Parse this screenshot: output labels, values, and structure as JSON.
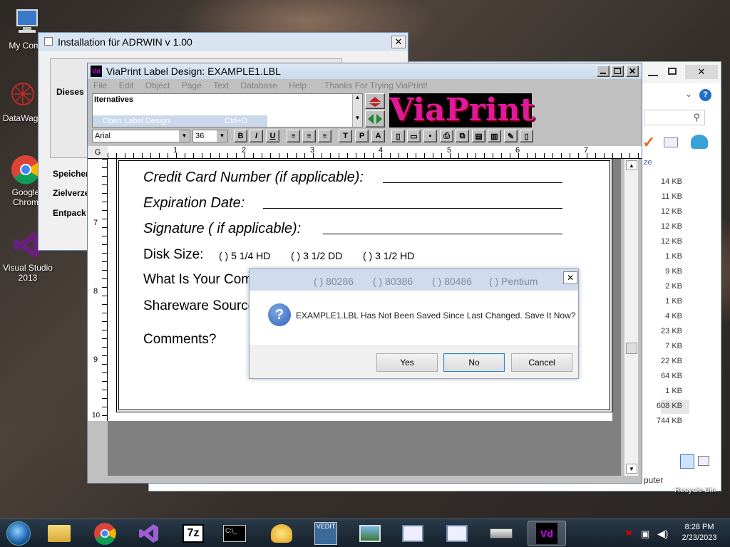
{
  "desktop": {
    "icons": [
      {
        "label": "My Comp"
      },
      {
        "label": "DataWage"
      },
      {
        "label": "Google Chrom"
      },
      {
        "label": "Visual Studio 2013"
      }
    ],
    "recycle_bin": "Recycle Bin"
  },
  "explorer": {
    "search_glyph": "⚲",
    "column_header": "ze",
    "sizes": [
      "14 KB",
      "11 KB",
      "12 KB",
      "12 KB",
      "12 KB",
      "1 KB",
      "9 KB",
      "2 KB",
      "1 KB",
      "4 KB",
      "23 KB",
      "7 KB",
      "22 KB",
      "64 KB",
      "1 KB",
      "608 KB",
      "744 KB"
    ],
    "nav_computer": "puter",
    "help_glyph": "?"
  },
  "install": {
    "title": "Installation für ADRWIN v 1.00",
    "label_dieses": "Dieses",
    "label_speicher": "Speicher",
    "label_zielverz": "Zielverze",
    "label_entpack": "Entpack"
  },
  "viaprint": {
    "title": "ViaPrint Label Design: EXAMPLE1.LBL",
    "menu": [
      "File",
      "Edit",
      "Object",
      "Page",
      "Text",
      "Database",
      "Help"
    ],
    "trial_text": "Thanks For Trying ViaPrint!",
    "list_header": "Iternatives",
    "list_selected": "Open Label Design",
    "list_selected_shortcut": "Ctrl+O",
    "logo": "ViaPrint",
    "font_name": "Arial",
    "font_size": "36",
    "fmt_bold": "B",
    "fmt_italic": "I",
    "fmt_underline": "U",
    "tool_t": "T",
    "tool_p": "P",
    "tool_a": "A",
    "ruler_corner": "G",
    "ruler_top": [
      "1",
      "2",
      "3",
      "4",
      "5",
      "6",
      "7"
    ],
    "ruler_left": [
      "7",
      "8",
      "9",
      "10"
    ],
    "doc": {
      "credit_card": "Credit Card Number (if applicable):",
      "expiration": "Expiration Date:",
      "signature": "Signature ( if applicable):",
      "disk_size": "Disk Size:",
      "disk_opts": [
        "( ) 5 1/4 HD",
        "( ) 3 1/2 DD",
        "( ) 3 1/2 HD"
      ],
      "computer": "What Is Your Computer?",
      "computer_opts": [
        "( ) 80286",
        "( ) 80386",
        "( ) 80486",
        "( ) Pentium"
      ],
      "shareware": "Shareware Source:",
      "comments": "Comments?"
    }
  },
  "dialog": {
    "message": "EXAMPLE1.LBL Has Not Been Saved Since Last Changed. Save It Now?",
    "yes": "Yes",
    "no": "No",
    "cancel": "Cancel",
    "close": "✕"
  },
  "tray": {
    "time": "8:28 PM",
    "date": "2/23/2023",
    "taskbar_7z": "7z",
    "taskbar_vedit": "VEDIT"
  },
  "colors": {
    "logo_fill": "#e0199a",
    "dialog_icon": "#2f63b8",
    "taskbar": "#1d2b38"
  }
}
